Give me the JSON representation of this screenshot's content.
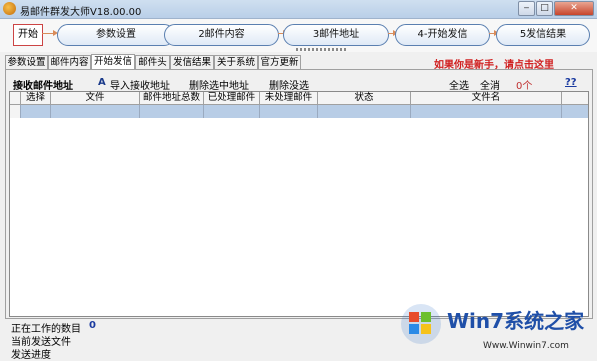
{
  "window": {
    "title": "易邮件群发大师V18.00.00"
  },
  "steps": {
    "start": "开始",
    "items": [
      "参数设置",
      "2邮件内容",
      "3邮件地址",
      "4-开始发信",
      "5发信结果"
    ]
  },
  "tabs": [
    "参数设置",
    "邮件内容",
    "开始发信",
    "邮件头",
    "发信结果",
    "关于系统",
    "官方更新"
  ],
  "newbie_link": "如果你是新手，请点击这里",
  "toolbar": {
    "section_label": "接收邮件地址",
    "import_label": "导入接收地址",
    "delete_selected": "删除选中地址",
    "delete_sent": "删除没选",
    "select_all": "全选",
    "clear_all": "全消",
    "count": "0个",
    "help": "??"
  },
  "table": {
    "columns": [
      "选择",
      "文件",
      "邮件地址总数",
      "已处理邮件",
      "未处理邮件",
      "状态",
      "文件名"
    ]
  },
  "status": {
    "working_count_label": "正在工作的数目",
    "working_count_value": "0",
    "current_file_label": "当前发送文件",
    "progress_label": "发送进度"
  },
  "watermark": {
    "brand": "Win7系统之家",
    "url": "Www.Winwin7.com"
  }
}
